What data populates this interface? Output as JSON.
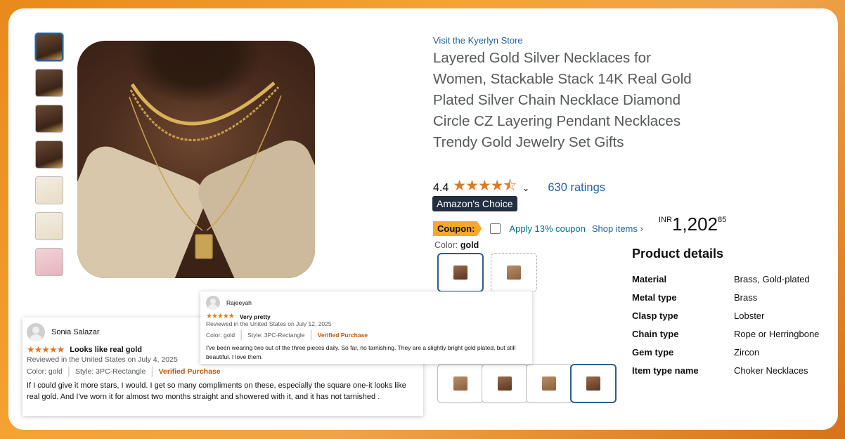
{
  "store_link": "Visit the Kyerlyn Store",
  "product_title": "Layered Gold Silver Necklaces for Women, Stackable Stack 14K Real Gold Plated Silver Chain Necklace Diamond Circle CZ Layering Pendant Necklaces Trendy Gold Jewelry Set Gifts",
  "rating": {
    "value": "4.4",
    "stars": 4.4,
    "stars_glyphs": "★★★★⯪",
    "count_label": "630 ratings"
  },
  "badge": "Amazon's Choice",
  "coupon": {
    "badge": "Coupon:",
    "text": "Apply 13% coupon",
    "shop_link": "Shop items ›"
  },
  "price": {
    "currency": "INR",
    "whole": "1,202",
    "fraction": "85"
  },
  "color": {
    "label": "Color:",
    "value": "gold"
  },
  "product_details": {
    "heading": "Product details",
    "rows": [
      {
        "key": "Material",
        "value": "Brass, Gold-plated"
      },
      {
        "key": "Metal type",
        "value": "Brass"
      },
      {
        "key": "Clasp type",
        "value": "Lobster"
      },
      {
        "key": "Chain type",
        "value": "Rope or Herringbone"
      },
      {
        "key": "Gem type",
        "value": "Zircon"
      },
      {
        "key": "Item type name",
        "value": "Choker Necklaces"
      }
    ]
  },
  "reviews": [
    {
      "name": "Sonia Salazar",
      "stars": "★★★★★",
      "title": "Looks like real gold",
      "date_line": "Reviewed in the United States on July 4, 2025",
      "color": "Color: gold",
      "style": "Style: 3PC-Rectangle",
      "verified": "Verified Purchase",
      "body": "If I could give it more stars, I would. I get so many compliments on these, especially the square one-it looks like real gold. And I've worn it for almost two months straight and showered with it, and it has not tarnished ."
    },
    {
      "name": "Rajeeyah",
      "stars": "★★★★★",
      "title": "Very pretty",
      "date_line": "Reviewed in the United States on July 12, 2025",
      "color": "Color: gold",
      "style": "Style: 3PC-Rectangle",
      "verified": "Verified Purchase",
      "body": "I've been wearing two out of the three pieces daily. So far, no tarnishing. They are a slightly bright gold plated, but still beautiful. I love them."
    }
  ],
  "colors": {
    "accent_star": "#de7921",
    "link": "#2162a1",
    "badge_bg": "#232f3e",
    "coupon_bg": "#f7a72b",
    "verified": "#c45500",
    "background": "#f0a449"
  }
}
